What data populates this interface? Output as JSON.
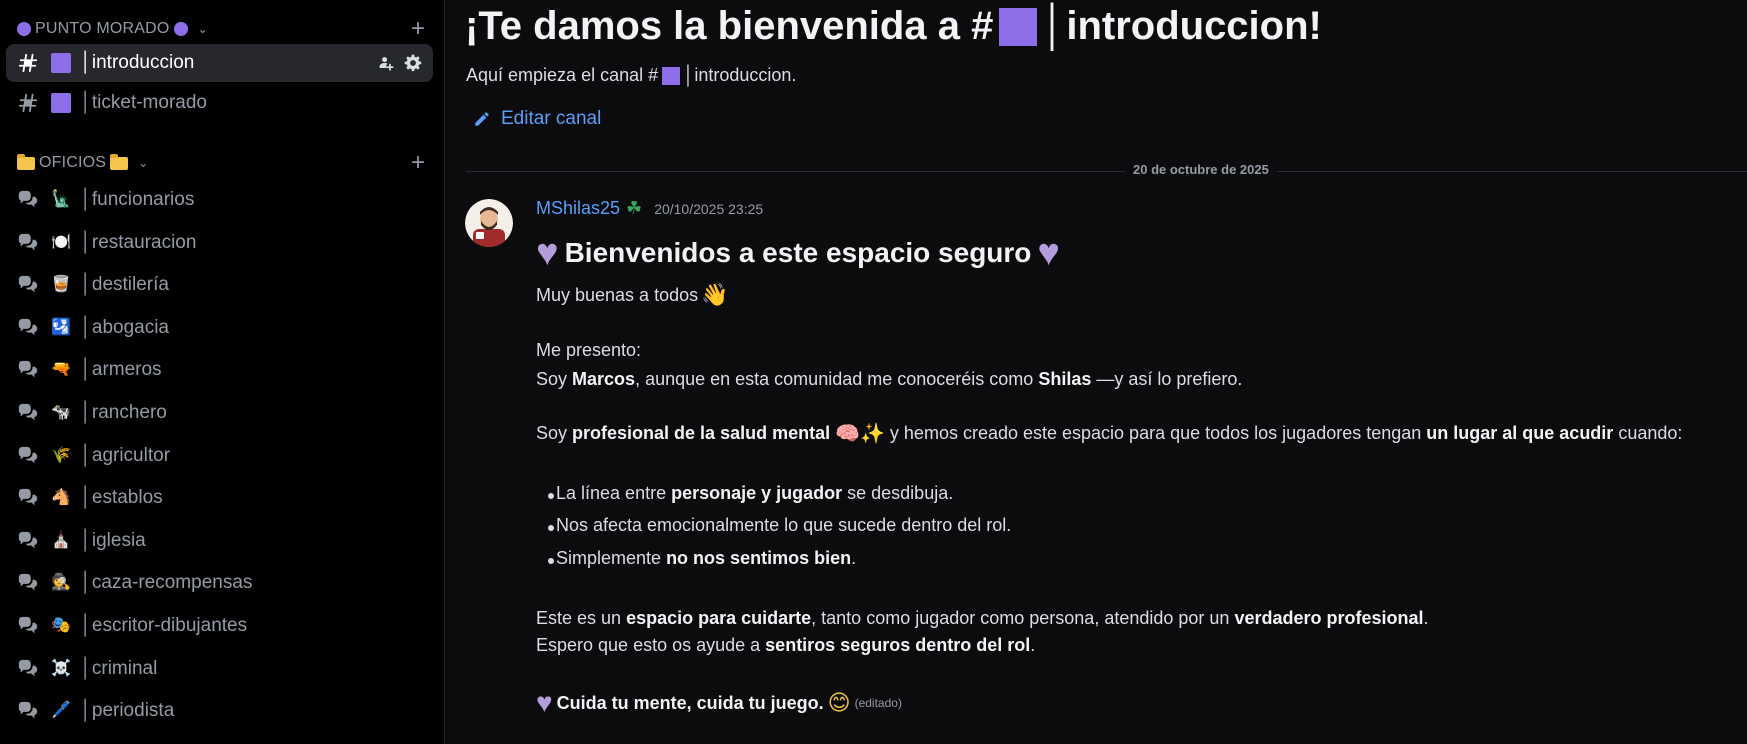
{
  "sidebar": {
    "categories": [
      {
        "name": "PUNTO MORADO",
        "add_label": "+"
      },
      {
        "name": "OFICIOS",
        "add_label": "+"
      }
    ],
    "channels_top": [
      {
        "emoji": "square",
        "name": "│introduccion",
        "active": true
      },
      {
        "emoji": "square",
        "name": "│ticket-morado",
        "active": false
      }
    ],
    "channels_oficios": [
      {
        "emoji": "🗽",
        "name": "│funcionarios"
      },
      {
        "emoji": "🍽️",
        "name": "│restauracion"
      },
      {
        "emoji": "🥃",
        "name": "│destilería"
      },
      {
        "emoji": "🛂",
        "name": "│abogacia"
      },
      {
        "emoji": "🔫",
        "name": "│armeros"
      },
      {
        "emoji": "🐄",
        "name": "│ranchero"
      },
      {
        "emoji": "🌾",
        "name": "│agricultor"
      },
      {
        "emoji": "🐴",
        "name": "│establos"
      },
      {
        "emoji": "⛪",
        "name": "│iglesia"
      },
      {
        "emoji": "🕵️",
        "name": "│caza-recompensas"
      },
      {
        "emoji": "🎭",
        "name": "│escritor-dibujantes"
      },
      {
        "emoji": "☠️",
        "name": "│criminal"
      },
      {
        "emoji": "🖊️",
        "name": "│periodista"
      }
    ],
    "icons": {
      "text_channel": "hash-icon",
      "forum_channel": "forum-icon",
      "invite": "add-member-icon",
      "settings": "gear-icon"
    }
  },
  "main": {
    "title_prefix": "¡Te damos la bienvenida a #",
    "title_suffix": "│introduccion!",
    "subtitle_prefix": "Aquí empieza el canal #",
    "subtitle_suffix": "│introduccion.",
    "edit_label": "Editar canal",
    "date_divider": "20 de octubre de 2025"
  },
  "message": {
    "author": "MShilas25",
    "timestamp": "20/10/2025 23:25",
    "heading": "Bienvenidos a este espacio seguro",
    "greeting": "Muy buenas a todos",
    "intro_label": "Me presento:",
    "line_soy_1": "Soy ",
    "name_marcos": "Marcos",
    "line_soy_2": ", aunque en esta comunidad me conoceréis como ",
    "name_shilas": "Shilas",
    "line_soy_3": " —y así lo prefiero.",
    "p2_1": "Soy ",
    "p2_bold": "profesional de la salud mental",
    "p2_2": " y hemos creado este espacio para que todos los jugadores tengan ",
    "p2_bold2": "un lugar al que acudir",
    "p2_3": " cuando:",
    "b1_1": "La línea entre ",
    "b1_bold": "personaje y jugador",
    "b1_2": " se desdibuja.",
    "b2": "Nos afecta emocionalmente lo que sucede dentro del rol.",
    "b3_1": "Simplemente ",
    "b3_bold": "no nos sentimos bien",
    "b3_2": ".",
    "p3_1": "Este es un ",
    "p3_bold": "espacio para cuidarte",
    "p3_2": ", tanto como jugador como persona, atendido por un ",
    "p3_bold2": "verdadero profesional",
    "p3_3": ".",
    "p4_1": "Espero que esto os ayude a ",
    "p4_bold": "sentiros seguros dentro del rol",
    "p4_2": ".",
    "closing": "Cuida tu mente, cuida tu juego.",
    "edited": "(editado)"
  },
  "colors": {
    "accent_purple": "#8e6ee8",
    "link_blue": "#5b9ef8",
    "heart": "#b39ddb"
  }
}
